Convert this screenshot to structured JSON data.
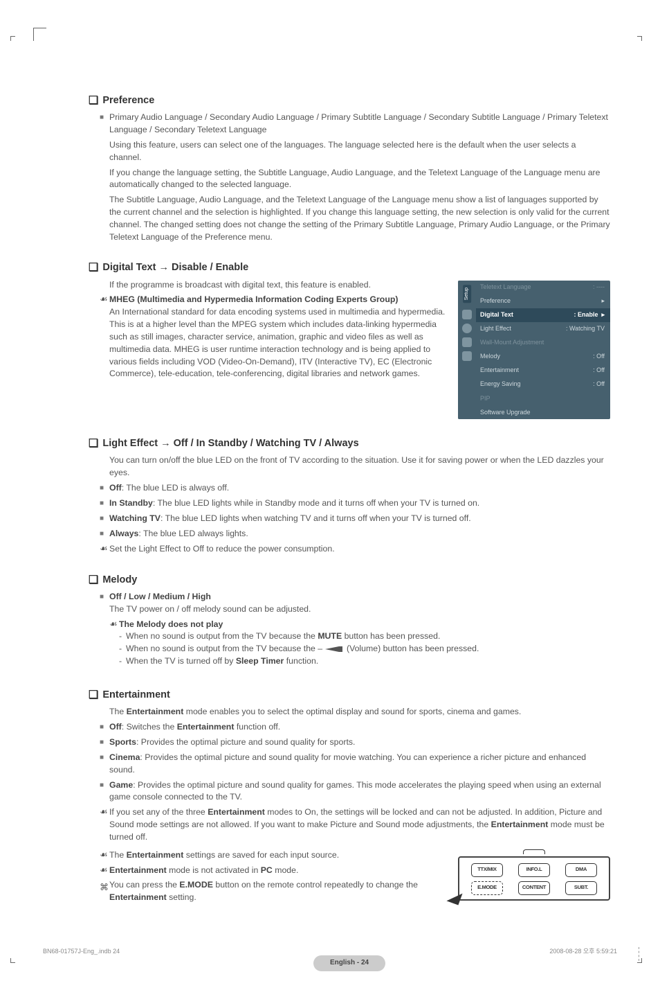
{
  "h_preference": "Preference",
  "pref_p1": "Primary Audio Language / Secondary Audio Language / Primary Subtitle Language / Secondary Subtitle Language / Primary Teletext Language / Secondary Teletext Language",
  "pref_p2": "Using this feature, users can select one of the languages. The language selected here is the default when the user selects a channel.",
  "pref_p3": "If you change the language setting, the Subtitle Language, Audio Language, and the Teletext Language of the Language menu are automatically changed to the selected language.",
  "pref_p4": "The Subtitle Language, Audio Language, and the Teletext Language of the Language menu show a list of languages supported by the current channel and the selection is highlighted. If you change this language setting, the new selection is only valid for the current channel. The changed setting does not change the setting of the Primary Subtitle Language, Primary Audio Language, or the Primary Teletext Language of the Preference menu.",
  "h_digital": "Digital Text → Disable / Enable",
  "dig_intro": "If the programme is broadcast with digital text, this feature is enabled.",
  "mheg_title": "MHEG (Multimedia and Hypermedia Information Coding Experts Group)",
  "mheg_body": "An International standard for data encoding systems used in multimedia and hypermedia. This is at a higher level than the MPEG system which includes data-linking hypermedia such as still images, character service, animation, graphic and video files as well as multimedia data. MHEG is user runtime interaction technology and is being applied to various fields including VOD (Video-On-Demand), ITV (Interactive TV), EC (Electronic Commerce), tele-education, tele-conferencing, digital libraries and network games.",
  "h_light": "Light Effect → Off / In Standby / Watching TV / Always",
  "light_intro": "You can turn on/off the blue LED on the front of TV according to the situation. Use it for saving power or when the LED dazzles your eyes.",
  "light_off_b": "Off",
  "light_off_t": ": The blue LED is always off.",
  "light_stb_b": "In Standby",
  "light_stb_t": ": The blue LED lights while in Standby mode and it turns off when your TV is turned on.",
  "light_tv_b": "Watching TV",
  "light_tv_t": ": The blue LED lights when watching TV and it turns off when your TV is turned off.",
  "light_al_b": "Always",
  "light_al_t": ": The blue LED always lights.",
  "light_note": "Set the Light Effect to Off to reduce the power consumption.",
  "h_melody": "Melody",
  "melody_opts": "Off / Low / Medium / High",
  "melody_intro": "The TV power on / off melody sound can be adjusted.",
  "melody_np": "The Melody does not play",
  "melody_d1a": "When no sound is output from the TV because the ",
  "melody_d1b": "MUTE",
  "melody_d1c": " button has been pressed.",
  "melody_d2a": "When no sound is output from the TV because the – ",
  "melody_d2b": " (Volume) button has been pressed.",
  "melody_d3a": "When the TV is turned off by ",
  "melody_d3b": "Sleep Timer",
  "melody_d3c": " function.",
  "h_ent": "Entertainment",
  "ent_intro_a": "The ",
  "ent_intro_b": "Entertainment",
  "ent_intro_c": " mode enables you to select the optimal display and sound for sports, cinema and games.",
  "ent_off_b": "Off",
  "ent_off_a": ": Switches the ",
  "ent_off_b2": "Entertainment",
  "ent_off_c": " function off.",
  "ent_sp_b": "Sports",
  "ent_sp_t": ": Provides the optimal picture and sound quality for sports.",
  "ent_ci_b": "Cinema",
  "ent_ci_t": ": Provides the optimal picture and sound quality for movie watching. You can experience a richer picture and enhanced sound.",
  "ent_ga_b": "Game",
  "ent_ga_t": ": Provides the optimal picture and sound quality for games. This mode accelerates the playing speed when using an external game console connected to the TV.",
  "ent_n1a": "If you set any of the three ",
  "ent_n1b": "Entertainment",
  "ent_n1c": " modes to On, the settings will be locked and can not be adjusted. In addition, Picture and Sound mode settings are not allowed. If you want to make Picture and Sound mode adjustments, the ",
  "ent_n1d": "Entertainment",
  "ent_n1e": " mode must be turned off.",
  "ent_n2a": "The ",
  "ent_n2b": "Entertainment",
  "ent_n2c": " settings are saved for each input source.",
  "ent_n3a": "Entertainment",
  "ent_n3b": " mode is not activated in ",
  "ent_n3c": "PC",
  "ent_n3d": " mode.",
  "ent_n4a": "You can press the ",
  "ent_n4b": "E.MODE",
  "ent_n4c": " button on the remote control repeatedly to change the ",
  "ent_n4d": "Entertainment",
  "ent_n4e": " setting.",
  "osd": {
    "setup": "Setup",
    "items": [
      {
        "label": "Teletext Language",
        "value": ": ----",
        "dim": true
      },
      {
        "label": "Preference",
        "value": ""
      },
      {
        "label": "Digital Text",
        "value": ": Enable",
        "active": true
      },
      {
        "label": "Light Effect",
        "value": ": Watching TV"
      },
      {
        "label": "Wall-Mount Adjustment",
        "value": "",
        "dim": true
      },
      {
        "label": "Melody",
        "value": ": Off"
      },
      {
        "label": "Entertainment",
        "value": ": Off"
      },
      {
        "label": "Energy Saving",
        "value": ": Off"
      },
      {
        "label": "PIP",
        "value": "",
        "dim": true
      },
      {
        "label": "Software Upgrade",
        "value": ""
      }
    ]
  },
  "remote": {
    "b1": "TTX/MIX",
    "b2": "INFO.L",
    "b3": "DMA",
    "b4": "E.MODE",
    "b5": "CONTENT",
    "b6": "SUBT."
  },
  "pagenum": "English - 24",
  "footer_l": "BN68-01757J-Eng_.indb   24",
  "footer_r": "2008-08-28   오후 5:59:21"
}
